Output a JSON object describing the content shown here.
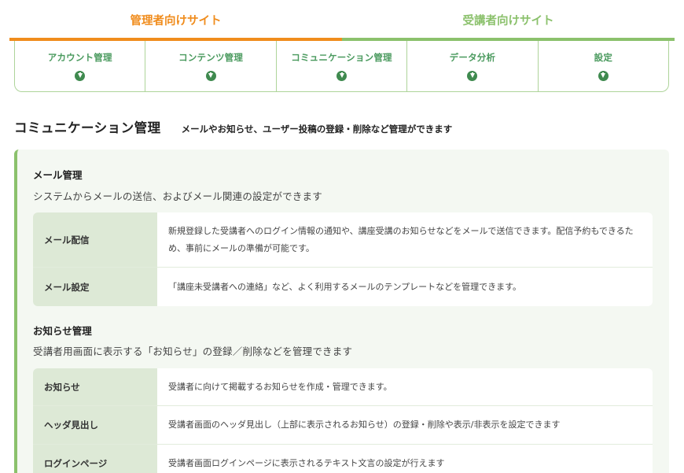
{
  "site_tabs": {
    "admin": "管理者向けサイト",
    "student": "受講者向けサイト"
  },
  "menu": [
    {
      "label": "アカウント管理",
      "icon": "download-circle-icon"
    },
    {
      "label": "コンテンツ管理",
      "icon": "download-circle-icon"
    },
    {
      "label": "コミュニケーション管理",
      "icon": "download-circle-icon"
    },
    {
      "label": "データ分析",
      "icon": "download-circle-icon"
    },
    {
      "label": "設定",
      "icon": "download-circle-icon"
    }
  ],
  "section": {
    "title": "コミュニケーション管理",
    "description": "メールやお知らせ、ユーザー投稿の登録・削除など管理ができます"
  },
  "groups": [
    {
      "title": "メール管理",
      "description": "システムからメールの送信、およびメール関連の設定ができます",
      "rows": [
        {
          "name": "メール配信",
          "text": "新規登録した受講者へのログイン情報の通知や、講座受講のお知らせなどをメールで送信できます。配信予約もできるため、事前にメールの準備が可能です。"
        },
        {
          "name": "メール設定",
          "text": "「講座未受講者への連絡」など、よく利用するメールのテンプレートなどを管理できます。"
        }
      ]
    },
    {
      "title": "お知らせ管理",
      "description": "受講者用画面に表示する「お知らせ」の登録／削除などを管理できます",
      "rows": [
        {
          "name": "お知らせ",
          "text": "受講者に向けて掲載するお知らせを作成・管理できます。"
        },
        {
          "name": "ヘッダ見出し",
          "text": "受講者画面のヘッダ見出し（上部に表示されるお知らせ）の登録・削除や表示/非表示を設定できます"
        },
        {
          "name": "ログインページ",
          "text": "受講者画面ログインページに表示されるテキスト文言の設定が行えます"
        }
      ]
    }
  ],
  "colors": {
    "admin_accent": "#f08c1c",
    "student_accent": "#8bc16c",
    "menu_text": "#4a9a5e",
    "row_head_bg": "#dde9d6",
    "panel_bg": "#f4f8f2"
  }
}
